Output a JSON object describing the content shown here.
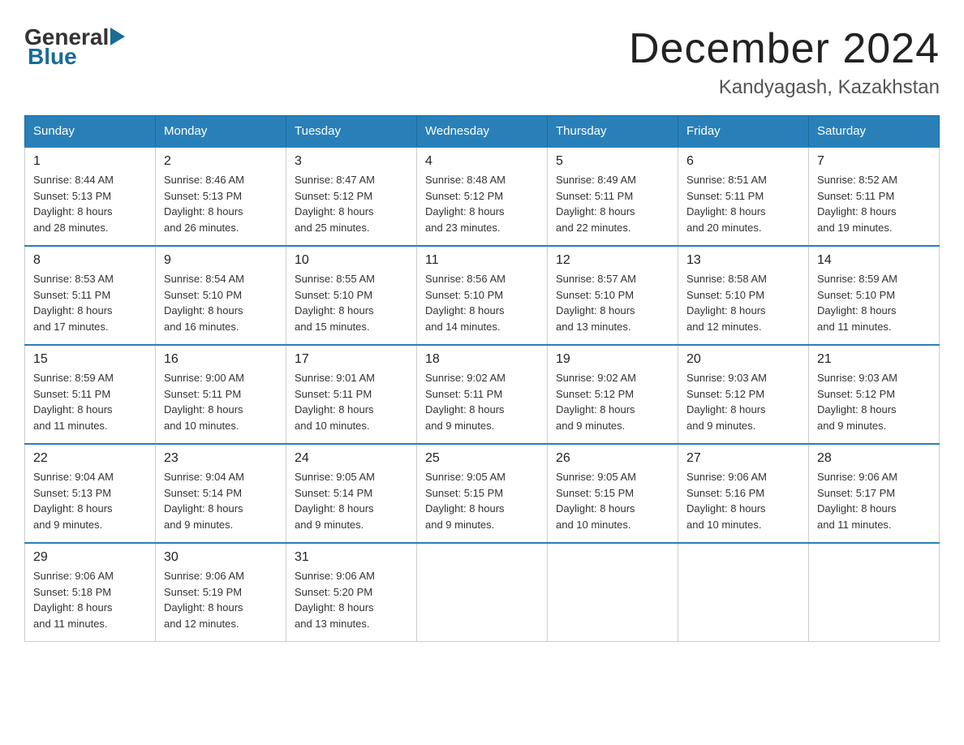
{
  "header": {
    "logo_general": "General",
    "logo_blue": "Blue",
    "title": "December 2024",
    "subtitle": "Kandyagash, Kazakhstan"
  },
  "days_of_week": [
    "Sunday",
    "Monday",
    "Tuesday",
    "Wednesday",
    "Thursday",
    "Friday",
    "Saturday"
  ],
  "weeks": [
    [
      {
        "day": "1",
        "sunrise": "8:44 AM",
        "sunset": "5:13 PM",
        "daylight": "8 hours and 28 minutes."
      },
      {
        "day": "2",
        "sunrise": "8:46 AM",
        "sunset": "5:13 PM",
        "daylight": "8 hours and 26 minutes."
      },
      {
        "day": "3",
        "sunrise": "8:47 AM",
        "sunset": "5:12 PM",
        "daylight": "8 hours and 25 minutes."
      },
      {
        "day": "4",
        "sunrise": "8:48 AM",
        "sunset": "5:12 PM",
        "daylight": "8 hours and 23 minutes."
      },
      {
        "day": "5",
        "sunrise": "8:49 AM",
        "sunset": "5:11 PM",
        "daylight": "8 hours and 22 minutes."
      },
      {
        "day": "6",
        "sunrise": "8:51 AM",
        "sunset": "5:11 PM",
        "daylight": "8 hours and 20 minutes."
      },
      {
        "day": "7",
        "sunrise": "8:52 AM",
        "sunset": "5:11 PM",
        "daylight": "8 hours and 19 minutes."
      }
    ],
    [
      {
        "day": "8",
        "sunrise": "8:53 AM",
        "sunset": "5:11 PM",
        "daylight": "8 hours and 17 minutes."
      },
      {
        "day": "9",
        "sunrise": "8:54 AM",
        "sunset": "5:10 PM",
        "daylight": "8 hours and 16 minutes."
      },
      {
        "day": "10",
        "sunrise": "8:55 AM",
        "sunset": "5:10 PM",
        "daylight": "8 hours and 15 minutes."
      },
      {
        "day": "11",
        "sunrise": "8:56 AM",
        "sunset": "5:10 PM",
        "daylight": "8 hours and 14 minutes."
      },
      {
        "day": "12",
        "sunrise": "8:57 AM",
        "sunset": "5:10 PM",
        "daylight": "8 hours and 13 minutes."
      },
      {
        "day": "13",
        "sunrise": "8:58 AM",
        "sunset": "5:10 PM",
        "daylight": "8 hours and 12 minutes."
      },
      {
        "day": "14",
        "sunrise": "8:59 AM",
        "sunset": "5:10 PM",
        "daylight": "8 hours and 11 minutes."
      }
    ],
    [
      {
        "day": "15",
        "sunrise": "8:59 AM",
        "sunset": "5:11 PM",
        "daylight": "8 hours and 11 minutes."
      },
      {
        "day": "16",
        "sunrise": "9:00 AM",
        "sunset": "5:11 PM",
        "daylight": "8 hours and 10 minutes."
      },
      {
        "day": "17",
        "sunrise": "9:01 AM",
        "sunset": "5:11 PM",
        "daylight": "8 hours and 10 minutes."
      },
      {
        "day": "18",
        "sunrise": "9:02 AM",
        "sunset": "5:11 PM",
        "daylight": "8 hours and 9 minutes."
      },
      {
        "day": "19",
        "sunrise": "9:02 AM",
        "sunset": "5:12 PM",
        "daylight": "8 hours and 9 minutes."
      },
      {
        "day": "20",
        "sunrise": "9:03 AM",
        "sunset": "5:12 PM",
        "daylight": "8 hours and 9 minutes."
      },
      {
        "day": "21",
        "sunrise": "9:03 AM",
        "sunset": "5:12 PM",
        "daylight": "8 hours and 9 minutes."
      }
    ],
    [
      {
        "day": "22",
        "sunrise": "9:04 AM",
        "sunset": "5:13 PM",
        "daylight": "8 hours and 9 minutes."
      },
      {
        "day": "23",
        "sunrise": "9:04 AM",
        "sunset": "5:14 PM",
        "daylight": "8 hours and 9 minutes."
      },
      {
        "day": "24",
        "sunrise": "9:05 AM",
        "sunset": "5:14 PM",
        "daylight": "8 hours and 9 minutes."
      },
      {
        "day": "25",
        "sunrise": "9:05 AM",
        "sunset": "5:15 PM",
        "daylight": "8 hours and 9 minutes."
      },
      {
        "day": "26",
        "sunrise": "9:05 AM",
        "sunset": "5:15 PM",
        "daylight": "8 hours and 10 minutes."
      },
      {
        "day": "27",
        "sunrise": "9:06 AM",
        "sunset": "5:16 PM",
        "daylight": "8 hours and 10 minutes."
      },
      {
        "day": "28",
        "sunrise": "9:06 AM",
        "sunset": "5:17 PM",
        "daylight": "8 hours and 11 minutes."
      }
    ],
    [
      {
        "day": "29",
        "sunrise": "9:06 AM",
        "sunset": "5:18 PM",
        "daylight": "8 hours and 11 minutes."
      },
      {
        "day": "30",
        "sunrise": "9:06 AM",
        "sunset": "5:19 PM",
        "daylight": "8 hours and 12 minutes."
      },
      {
        "day": "31",
        "sunrise": "9:06 AM",
        "sunset": "5:20 PM",
        "daylight": "8 hours and 13 minutes."
      },
      null,
      null,
      null,
      null
    ]
  ],
  "labels": {
    "sunrise": "Sunrise:",
    "sunset": "Sunset:",
    "daylight": "Daylight:"
  }
}
